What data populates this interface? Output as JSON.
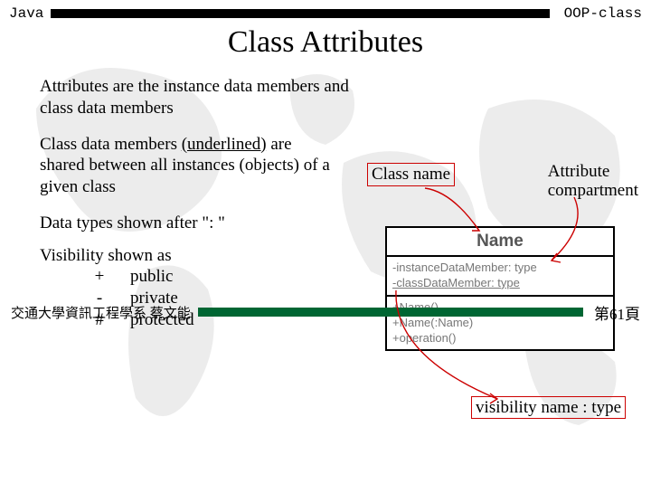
{
  "top": {
    "left": "Java",
    "right": "OOP-class"
  },
  "title": "Class Attributes",
  "p1": "Attributes are the instance data members and class data members",
  "p2a": "Class data members ",
  "p2b": "(underlined)",
  "p2c": " are shared between all instances (objects) of a given class",
  "p3": "Data types shown after \": \"",
  "vis": {
    "heading": "Visibility shown as",
    "rows": [
      {
        "sym": "+",
        "lbl": "public"
      },
      {
        "sym": "-",
        "lbl": "private"
      },
      {
        "sym": "#",
        "lbl": "protected"
      }
    ]
  },
  "labels": {
    "classname": "Class name",
    "attrcomp_l1": "Attribute",
    "attrcomp_l2": "compartment",
    "vislabel": "visibility name : type"
  },
  "uml": {
    "name": "Name",
    "attrs": [
      "-instanceDataMember: type",
      "-classDataMember: type"
    ],
    "ops": [
      "+Name()",
      "+Name(:Name)",
      "+operation()"
    ]
  },
  "footer": {
    "left": "交通大學資訊工程學系 蔡文能",
    "right": "第61頁"
  }
}
